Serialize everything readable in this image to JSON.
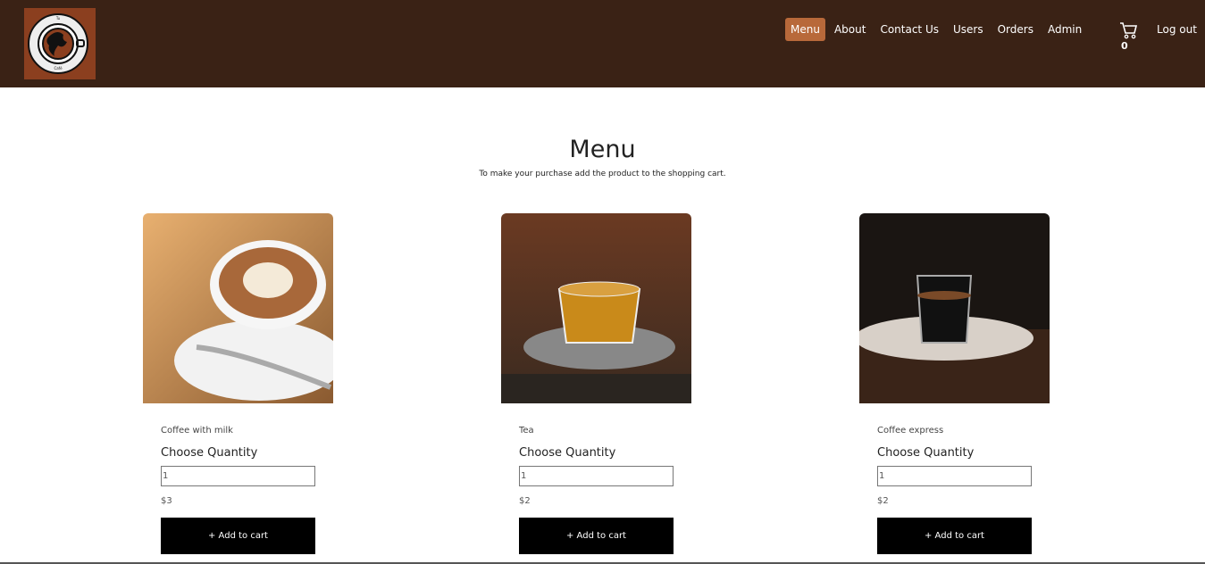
{
  "logo": {
    "top_text": "Tu",
    "bottom_text": "Café"
  },
  "nav": {
    "items": [
      {
        "label": "Menu",
        "active": true
      },
      {
        "label": "About"
      },
      {
        "label": "Contact Us"
      },
      {
        "label": "Users"
      },
      {
        "label": "Orders"
      },
      {
        "label": "Admin"
      }
    ],
    "cart_count": "0",
    "logout": "Log out"
  },
  "page": {
    "title": "Menu",
    "subtitle": "To make your purchase add the product to the shopping cart."
  },
  "products": [
    {
      "name": "Coffee with milk",
      "choose_label": "Choose Quantity",
      "quantity": "1",
      "price": "$3",
      "button": "+ Add to cart"
    },
    {
      "name": "Tea",
      "choose_label": "Choose Quantity",
      "quantity": "1",
      "price": "$2",
      "button": "+ Add to cart"
    },
    {
      "name": "Coffee express",
      "choose_label": "Choose Quantity",
      "quantity": "1",
      "price": "$2",
      "button": "+ Add to cart"
    }
  ],
  "colors": {
    "header": "#3a2215",
    "active_nav": "#b8693a",
    "logo_bg": "#8b3f1f",
    "button": "#000000"
  }
}
